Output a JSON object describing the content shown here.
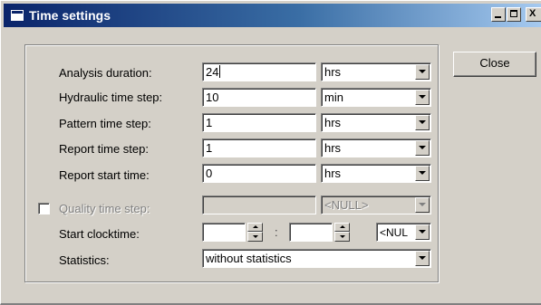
{
  "window": {
    "title": "Time settings",
    "controls": {
      "minimize": "_",
      "close": "X"
    }
  },
  "rows": {
    "analysis_duration": {
      "label": "Analysis duration:",
      "value": "24",
      "unit": "hrs"
    },
    "hydraulic_time_step": {
      "label": "Hydraulic time step:",
      "value": "10",
      "unit": "min"
    },
    "pattern_time_step": {
      "label": "Pattern time step:",
      "value": "1",
      "unit": "hrs"
    },
    "report_time_step": {
      "label": "Report time step:",
      "value": "1",
      "unit": "hrs"
    },
    "report_start_time": {
      "label": "Report start time:",
      "value": "0",
      "unit": "hrs"
    },
    "quality_time_step": {
      "label": "Quality time step:",
      "value": "",
      "unit": "<NULL>",
      "enabled": false,
      "checked": false
    }
  },
  "start_clocktime": {
    "label": "Start clocktime:",
    "hours": "",
    "separator": ":",
    "minutes": "",
    "ampm": "<NUL"
  },
  "statistics": {
    "label": "Statistics:",
    "value": "without statistics"
  },
  "buttons": {
    "close": "Close"
  },
  "icons": {
    "window": "window-icon",
    "dropdown": "chevron-down-icon",
    "spin_up": "spin-up-icon",
    "spin_down": "spin-down-icon"
  },
  "colors": {
    "title_start": "#0a246a",
    "title_end": "#a6caf0",
    "face": "#d4d0c8",
    "disabled_text": "#808080"
  }
}
